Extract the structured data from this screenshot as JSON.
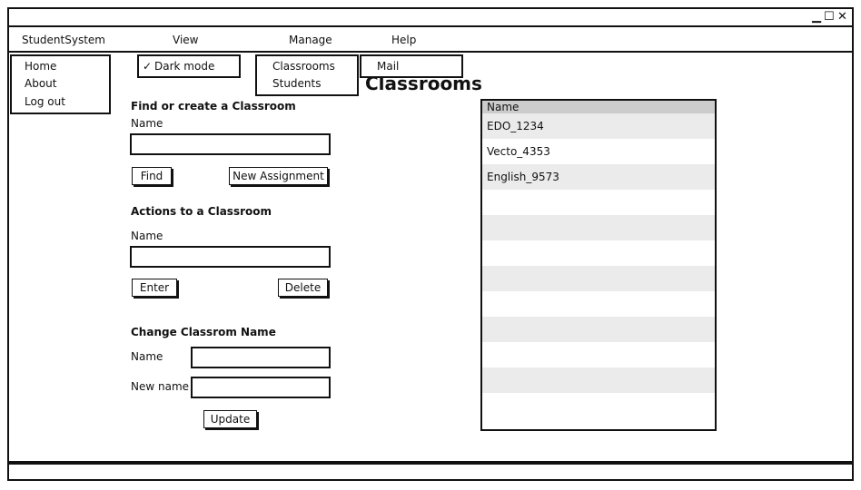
{
  "menubar": {
    "items": [
      "StudentSystem",
      "View",
      "Manage",
      "Help"
    ]
  },
  "window_controls": {
    "minimize": "▁",
    "maximize": "☐",
    "close": "✕"
  },
  "dropdowns": {
    "studentsystem": [
      "Home",
      "About",
      "Log out"
    ],
    "view": {
      "check": "✓",
      "label": "Dark mode"
    },
    "manage": [
      "Classrooms",
      "Students"
    ],
    "help": [
      "Mail"
    ]
  },
  "page": {
    "title": "Classrooms"
  },
  "find_section": {
    "heading": "Find or create a Classroom",
    "name_label": "Name",
    "name_value": "",
    "find_button": "Find",
    "new_button": "New Assignment"
  },
  "actions_section": {
    "heading": "Actions to a Classroom",
    "name_label": "Name",
    "name_value": "",
    "enter_button": "Enter",
    "delete_button": "Delete"
  },
  "rename_section": {
    "heading": "Change Classrom Name",
    "name_label": "Name",
    "name_value": "",
    "new_name_label": "New name",
    "new_name_value": "",
    "update_button": "Update"
  },
  "table": {
    "header": "Name",
    "rows": [
      "EDO_1234",
      "Vecto_4353",
      "English_9573",
      "",
      "",
      "",
      "",
      "",
      "",
      "",
      "",
      ""
    ]
  }
}
